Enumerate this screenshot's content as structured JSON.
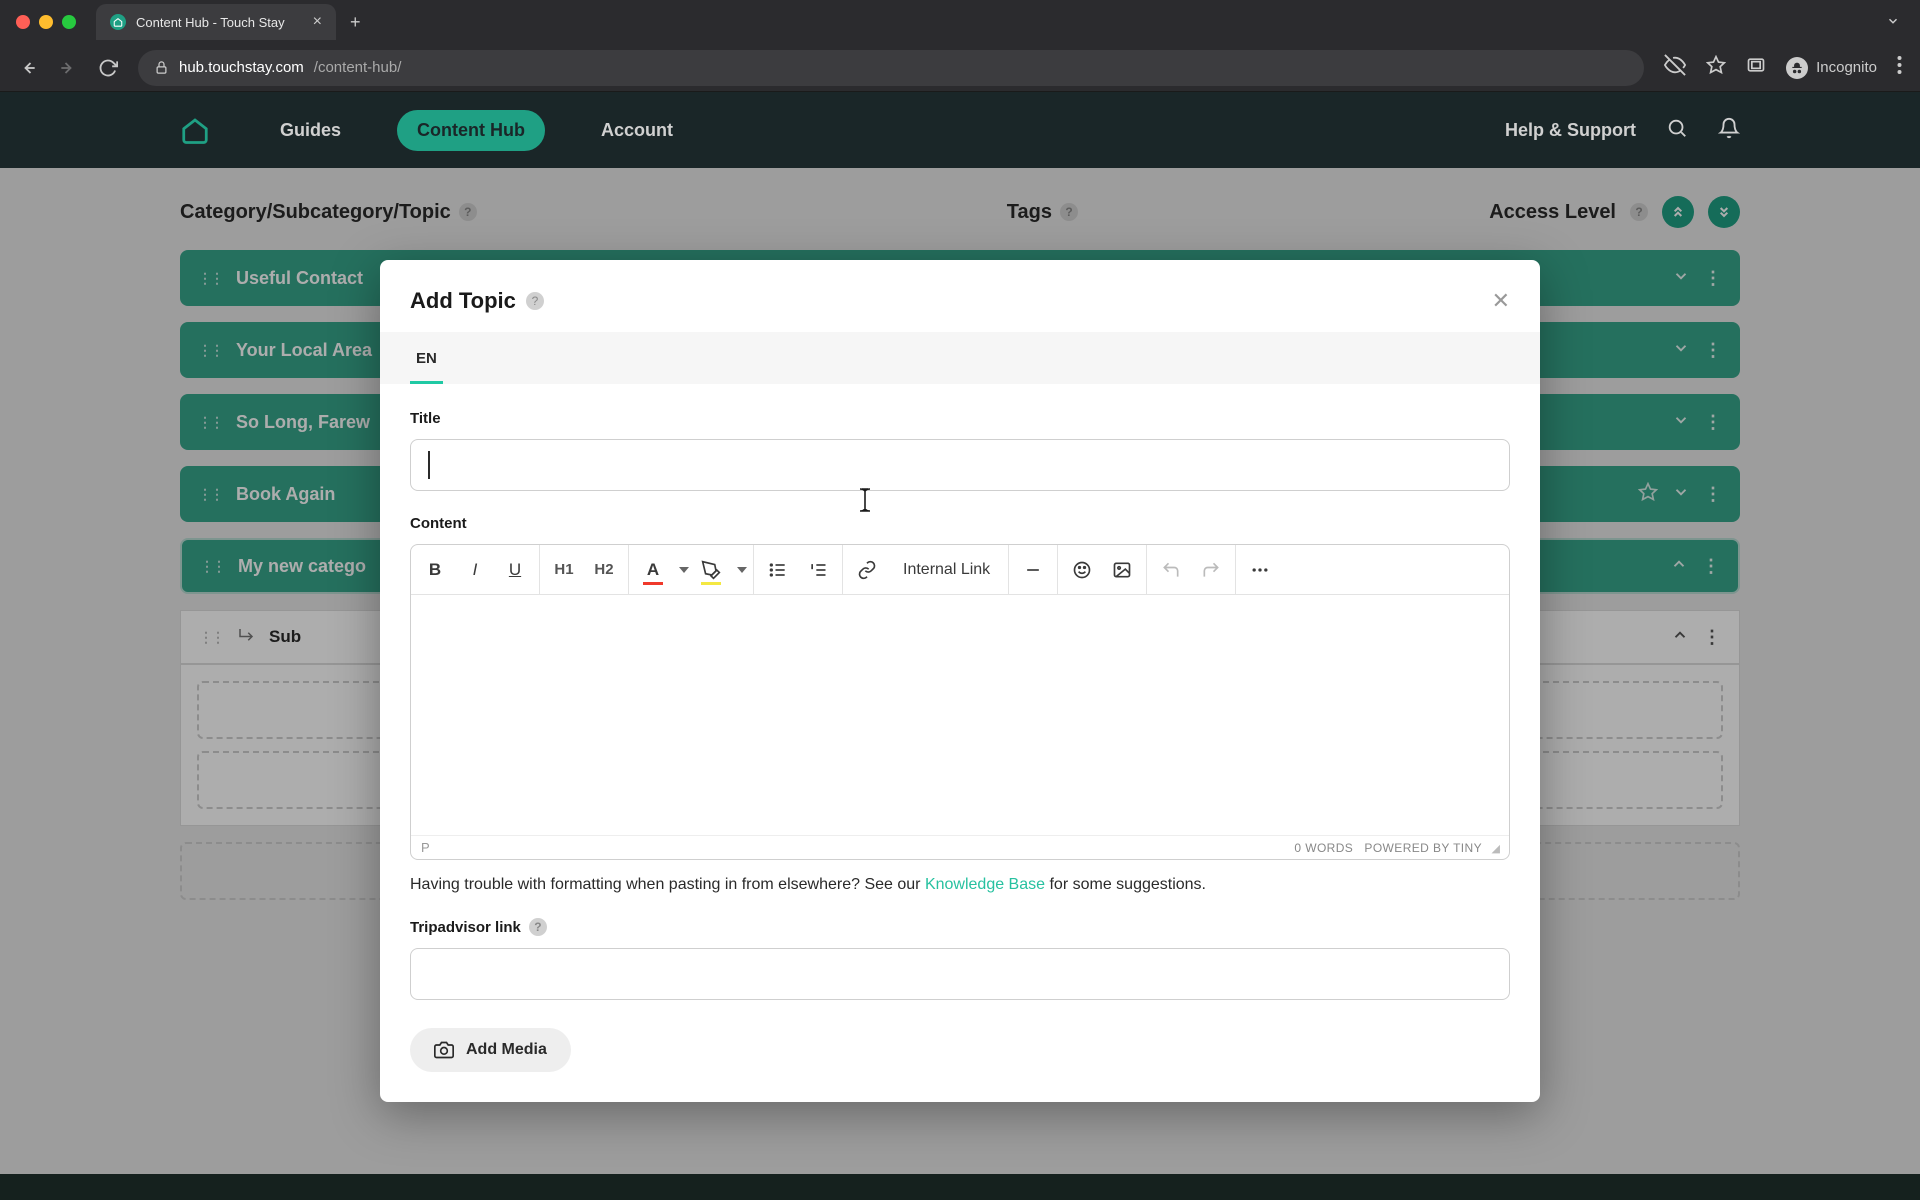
{
  "browser": {
    "tab_title": "Content Hub - Touch Stay",
    "url_host": "hub.touchstay.com",
    "url_path": "/content-hub/",
    "incognito_label": "Incognito"
  },
  "header": {
    "nav": {
      "guides": "Guides",
      "content_hub": "Content Hub",
      "account": "Account"
    },
    "help": "Help & Support"
  },
  "columns": {
    "left": "Category/Subcategory/Topic",
    "center": "Tags",
    "right": "Access Level"
  },
  "categories": [
    {
      "label": "Useful Contact"
    },
    {
      "label": "Your Local Area"
    },
    {
      "label": "So Long, Farew"
    },
    {
      "label": "Book Again"
    },
    {
      "label": "My new catego"
    }
  ],
  "sub": {
    "label": "Sub"
  },
  "modal": {
    "title": "Add Topic",
    "lang_tab": "EN",
    "title_label": "Title",
    "content_label": "Content",
    "title_value": "",
    "toolbar": {
      "h1": "H1",
      "h2": "H2",
      "internal_link": "Internal Link"
    },
    "status": {
      "path": "P",
      "words": "0 WORDS",
      "powered": "POWERED BY TINY"
    },
    "help_pre": "Having trouble with formatting when pasting in from elsewhere? See our ",
    "help_link": "Knowledge Base",
    "help_post": " for some suggestions.",
    "trip_label": "Tripadvisor link",
    "trip_value": "",
    "add_media": "Add Media"
  }
}
